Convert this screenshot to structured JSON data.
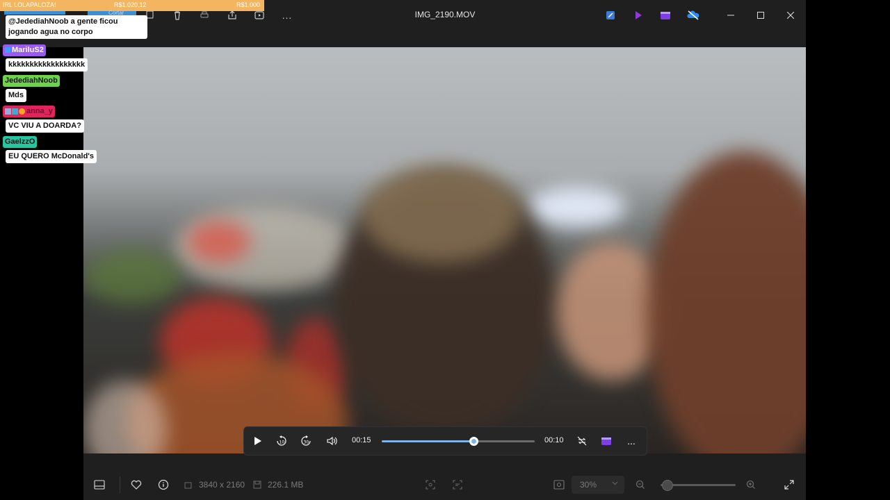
{
  "window": {
    "title": "IMG_2190.MOV"
  },
  "toolbar": {
    "crop_label": "Cortar",
    "more_label": "..."
  },
  "overlay": {
    "banner": {
      "left": "IRL LOLAPALOZA!",
      "middle": "R$1.020,12",
      "right": "R$1.000"
    },
    "chat": [
      {
        "user": "",
        "message": "@JedediahNoob a gente ficou jogando agua no corpo",
        "user_color": ""
      },
      {
        "user": "MariluS2",
        "message": "kkkkkkkkkkkkkkkkkk",
        "user_color": "#9b59f0"
      },
      {
        "user": "JedediahNoob",
        "message": "Mds",
        "user_color": "#6fd14c"
      },
      {
        "user": "anna_y",
        "message": "VC VIU A DOARDA?",
        "user_color": "#e0245e"
      },
      {
        "user": "GaelzzO",
        "message": "EU QUERO McDonald's",
        "user_color": "#26c6a0"
      }
    ]
  },
  "player": {
    "current_time": "00:15",
    "remaining_time": "00:10",
    "progress": 0.6
  },
  "status": {
    "resolution": "3840 x 2160",
    "file_size": "226.1 MB",
    "zoom": "30%",
    "zoom_slider": 0.08
  },
  "colors": {
    "accent": "#7fb3e6",
    "banner": "#f4b560"
  }
}
